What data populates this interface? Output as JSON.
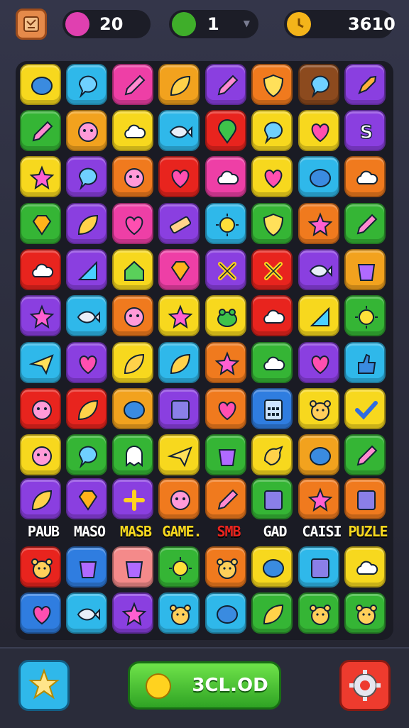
{
  "hud": {
    "lives": "20",
    "gems": "1",
    "timer_score": "3610",
    "icons": {
      "menu": "map-icon",
      "lives": "heart-icon",
      "gems": "green-gem-icon",
      "timer": "clock-icon"
    },
    "colors": {
      "heart": "#e040b0",
      "gem": "#3fae2a",
      "clock": "#f4b41a"
    }
  },
  "board": {
    "rows": [
      [
        {
          "c": "#f7d81e",
          "i": "blob"
        },
        {
          "c": "#2fb8ea",
          "i": "bubble"
        },
        {
          "c": "#ee3fa6",
          "i": "pencil"
        },
        {
          "c": "#f2a21e",
          "i": "leaf"
        },
        {
          "c": "#8a3fe0",
          "i": "pencil"
        },
        {
          "c": "#f07a1e",
          "i": "shield"
        },
        {
          "c": "#8c4a1e",
          "i": "bubble"
        },
        {
          "c": "#8a3fe0",
          "i": "rocket"
        }
      ],
      [
        {
          "c": "#35b535",
          "i": "pencil"
        },
        {
          "c": "#f2a21e",
          "i": "face"
        },
        {
          "c": "#f7d81e",
          "i": "cloud"
        },
        {
          "c": "#2fb8ea",
          "i": "fish"
        },
        {
          "c": "#e8241e",
          "i": "pin"
        },
        {
          "c": "#f7d81e",
          "i": "bubble"
        },
        {
          "c": "#f7d81e",
          "i": "heart"
        },
        {
          "c": "#8a3fe0",
          "i": "s"
        }
      ],
      [
        {
          "c": "#f7d81e",
          "i": "star"
        },
        {
          "c": "#8a3fe0",
          "i": "bubble"
        },
        {
          "c": "#f07a1e",
          "i": "face"
        },
        {
          "c": "#e8241e",
          "i": "heart"
        },
        {
          "c": "#ee3fa6",
          "i": "cloud"
        },
        {
          "c": "#f7d81e",
          "i": "heart"
        },
        {
          "c": "#2fb8ea",
          "i": "blob"
        },
        {
          "c": "#f07a1e",
          "i": "cloud"
        }
      ],
      [
        {
          "c": "#35b535",
          "i": "gem"
        },
        {
          "c": "#8a3fe0",
          "i": "leaf"
        },
        {
          "c": "#ee3fa6",
          "i": "heart"
        },
        {
          "c": "#8a3fe0",
          "i": "band"
        },
        {
          "c": "#2fb8ea",
          "i": "sun"
        },
        {
          "c": "#35b535",
          "i": "shield"
        },
        {
          "c": "#f07a1e",
          "i": "star"
        },
        {
          "c": "#35b535",
          "i": "pencil"
        }
      ],
      [
        {
          "c": "#e8241e",
          "i": "cloud"
        },
        {
          "c": "#8a3fe0",
          "i": "flag"
        },
        {
          "c": "#f7d81e",
          "i": "house"
        },
        {
          "c": "#ee3fa6",
          "i": "gem"
        },
        {
          "c": "#8a3fe0",
          "i": "x"
        },
        {
          "c": "#e8241e",
          "i": "x"
        },
        {
          "c": "#8a3fe0",
          "i": "fish"
        },
        {
          "c": "#f2a21e",
          "i": "cup"
        }
      ],
      [
        {
          "c": "#8a3fe0",
          "i": "star"
        },
        {
          "c": "#2fb8ea",
          "i": "fish"
        },
        {
          "c": "#f07a1e",
          "i": "face"
        },
        {
          "c": "#f7d81e",
          "i": "star"
        },
        {
          "c": "#f7d81e",
          "i": "frog"
        },
        {
          "c": "#e8241e",
          "i": "cloud"
        },
        {
          "c": "#f7d81e",
          "i": "flag"
        },
        {
          "c": "#35b535",
          "i": "sun"
        }
      ],
      [
        {
          "c": "#2fb8ea",
          "i": "plane"
        },
        {
          "c": "#8a3fe0",
          "i": "heart"
        },
        {
          "c": "#f7d81e",
          "i": "leaf"
        },
        {
          "c": "#2fb8ea",
          "i": "leaf"
        },
        {
          "c": "#f07a1e",
          "i": "star"
        },
        {
          "c": "#35b535",
          "i": "cloud"
        },
        {
          "c": "#8a3fe0",
          "i": "heart"
        },
        {
          "c": "#2fb8ea",
          "i": "thumb"
        }
      ],
      [
        {
          "c": "#e8241e",
          "i": "face"
        },
        {
          "c": "#e8241e",
          "i": "leaf"
        },
        {
          "c": "#f2a21e",
          "i": "blob"
        },
        {
          "c": "#8a3fe0",
          "i": "box"
        },
        {
          "c": "#f07a1e",
          "i": "heart"
        },
        {
          "c": "#2f7de0",
          "i": "calc"
        },
        {
          "c": "#f7d81e",
          "i": "bear"
        },
        {
          "c": "#f7d81e",
          "i": "check"
        }
      ],
      [
        {
          "c": "#f7d81e",
          "i": "face"
        },
        {
          "c": "#35b535",
          "i": "bubble"
        },
        {
          "c": "#35b535",
          "i": "ghost"
        },
        {
          "c": "#f7d81e",
          "i": "plane"
        },
        {
          "c": "#35b535",
          "i": "cup"
        },
        {
          "c": "#f7d81e",
          "i": "bird"
        },
        {
          "c": "#f2a21e",
          "i": "blob"
        },
        {
          "c": "#35b535",
          "i": "pencil"
        }
      ],
      [
        {
          "c": "#8a3fe0",
          "i": "leaf"
        },
        {
          "c": "#8a3fe0",
          "i": "gem"
        },
        {
          "c": "#8a3fe0",
          "i": "plus"
        },
        {
          "c": "#f07a1e",
          "i": "face"
        },
        {
          "c": "#f07a1e",
          "i": "pencil"
        },
        {
          "c": "#35b535",
          "i": "box"
        },
        {
          "c": "#f07a1e",
          "i": "star"
        },
        {
          "c": "#f07a1e",
          "i": "box"
        }
      ],
      [
        {
          "c": "#e8241e",
          "i": "bear"
        },
        {
          "c": "#2f7de0",
          "i": "cup"
        },
        {
          "c": "#f48a8a",
          "i": "cup"
        },
        {
          "c": "#35b535",
          "i": "sun"
        },
        {
          "c": "#f07a1e",
          "i": "bear"
        },
        {
          "c": "#f7d81e",
          "i": "blob"
        },
        {
          "c": "#2fb8ea",
          "i": "box"
        },
        {
          "c": "#f7d81e",
          "i": "cloud"
        }
      ],
      [
        {
          "c": "#2f7de0",
          "i": "heart"
        },
        {
          "c": "#2fb8ea",
          "i": "fish"
        },
        {
          "c": "#8a3fe0",
          "i": "star"
        },
        {
          "c": "#2fb8ea",
          "i": "bear"
        },
        {
          "c": "#2fb8ea",
          "i": "blob"
        },
        {
          "c": "#35b535",
          "i": "leaf"
        },
        {
          "c": "#35b535",
          "i": "bear"
        },
        {
          "c": "#35b535",
          "i": "bear"
        }
      ]
    ],
    "words": [
      {
        "text": "PAUB",
        "color": "#ffffff"
      },
      {
        "text": "MASO",
        "color": "#ffffff"
      },
      {
        "text": "MASB",
        "color": "#f7d81e"
      },
      {
        "text": "GAME.",
        "color": "#f7d81e"
      },
      {
        "text": "SMB",
        "color": "#e8241e"
      },
      {
        "text": "GAD",
        "color": "#ffffff"
      },
      {
        "text": "CAISI",
        "color": "#ffffff"
      },
      {
        "text": "PUZLE",
        "color": "#f7d81e"
      }
    ]
  },
  "bottom": {
    "find_label": "3CL.OD",
    "left_icon": "sparkle-icon",
    "right_icon": "gear-icon"
  }
}
